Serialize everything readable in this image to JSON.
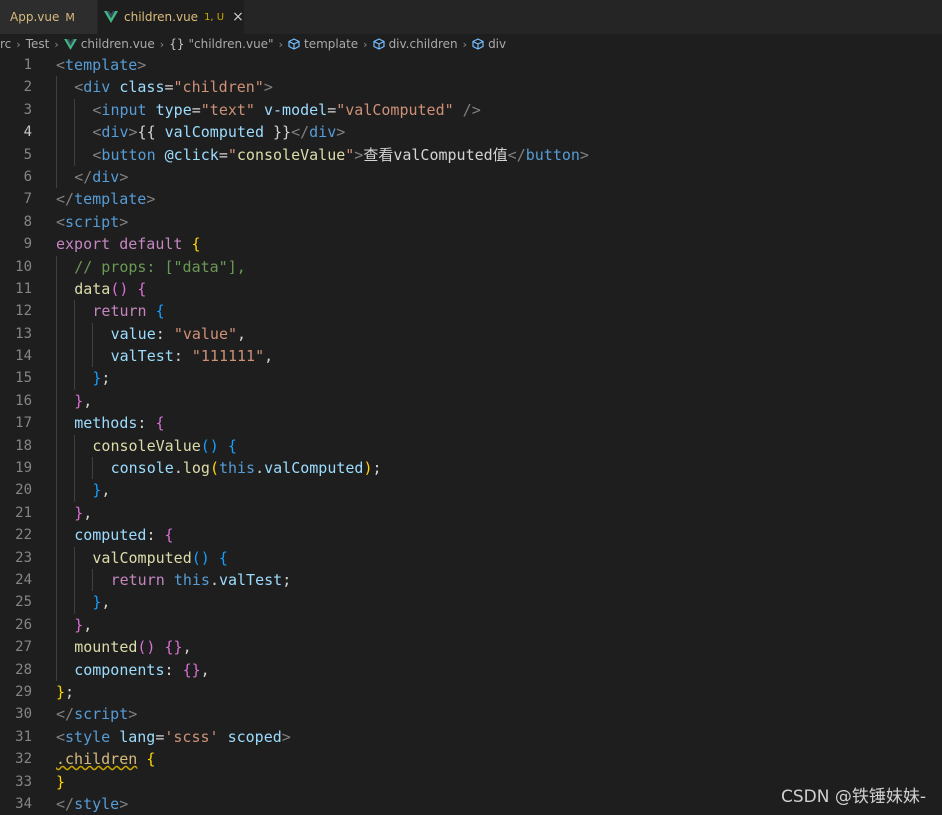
{
  "tabs": [
    {
      "label": "App.vue",
      "status": "M"
    },
    {
      "label": "children.vue",
      "status": "1, U",
      "close": "×"
    }
  ],
  "breadcrumb": [
    "rc",
    "Test",
    "children.vue",
    "\"children.vue\"",
    "template",
    "div.children",
    "div"
  ],
  "breadcrumb_braces": "{}",
  "editor": {
    "current_line": 4,
    "lines": [
      {
        "n": "1",
        "indent": 0,
        "tokens": [
          [
            "t-punct",
            "<"
          ],
          [
            "t-tag",
            "template"
          ],
          [
            "t-punct",
            ">"
          ]
        ]
      },
      {
        "n": "2",
        "indent": 1,
        "tokens": [
          [
            "t-punct",
            "<"
          ],
          [
            "t-tag",
            "div"
          ],
          [
            "t-text",
            " "
          ],
          [
            "t-attr",
            "class"
          ],
          [
            "t-text",
            "="
          ],
          [
            "t-str",
            "\"children\""
          ],
          [
            "t-punct",
            ">"
          ]
        ]
      },
      {
        "n": "3",
        "indent": 2,
        "tokens": [
          [
            "t-punct",
            "<"
          ],
          [
            "t-tag",
            "input"
          ],
          [
            "t-text",
            " "
          ],
          [
            "t-attr",
            "type"
          ],
          [
            "t-text",
            "="
          ],
          [
            "t-str",
            "\"text\""
          ],
          [
            "t-text",
            " "
          ],
          [
            "t-attr",
            "v-model"
          ],
          [
            "t-text",
            "="
          ],
          [
            "t-str",
            "\"valComputed\""
          ],
          [
            "t-text",
            " "
          ],
          [
            "t-punct",
            "/>"
          ]
        ]
      },
      {
        "n": "4",
        "indent": 2,
        "tokens": [
          [
            "t-punct",
            "<"
          ],
          [
            "t-tag",
            "div"
          ],
          [
            "t-punct",
            ">"
          ],
          [
            "t-text",
            "{{ "
          ],
          [
            "t-prop",
            "valComputed"
          ],
          [
            "t-text",
            " }}"
          ],
          [
            "t-punct",
            "</"
          ],
          [
            "t-tag",
            "div"
          ],
          [
            "t-punct",
            ">"
          ]
        ]
      },
      {
        "n": "5",
        "indent": 2,
        "tokens": [
          [
            "t-punct",
            "<"
          ],
          [
            "t-tag",
            "button"
          ],
          [
            "t-text",
            " "
          ],
          [
            "t-attr",
            "@click"
          ],
          [
            "t-text",
            "="
          ],
          [
            "t-str",
            "\""
          ],
          [
            "t-fn",
            "consoleValue"
          ],
          [
            "t-str",
            "\""
          ],
          [
            "t-punct",
            ">"
          ],
          [
            "t-text",
            "查看valComputed值"
          ],
          [
            "t-punct",
            "</"
          ],
          [
            "t-tag",
            "button"
          ],
          [
            "t-punct",
            ">"
          ]
        ]
      },
      {
        "n": "6",
        "indent": 1,
        "tokens": [
          [
            "t-punct",
            "</"
          ],
          [
            "t-tag",
            "div"
          ],
          [
            "t-punct",
            ">"
          ]
        ]
      },
      {
        "n": "7",
        "indent": 0,
        "tokens": [
          [
            "t-punct",
            "</"
          ],
          [
            "t-tag",
            "template"
          ],
          [
            "t-punct",
            ">"
          ]
        ]
      },
      {
        "n": "8",
        "indent": 0,
        "tokens": [
          [
            "t-punct",
            "<"
          ],
          [
            "t-tag",
            "script"
          ],
          [
            "t-punct",
            ">"
          ]
        ]
      },
      {
        "n": "9",
        "indent": 0,
        "tokens": [
          [
            "t-kw",
            "export"
          ],
          [
            "t-text",
            " "
          ],
          [
            "t-kw",
            "default"
          ],
          [
            "t-text",
            " "
          ],
          [
            "t-br1",
            "{"
          ]
        ]
      },
      {
        "n": "10",
        "indent": 1,
        "tokens": [
          [
            "t-comment",
            "// props: [\"data\"],"
          ]
        ]
      },
      {
        "n": "11",
        "indent": 1,
        "tokens": [
          [
            "t-fn",
            "data"
          ],
          [
            "t-br2",
            "()"
          ],
          [
            "t-text",
            " "
          ],
          [
            "t-br2",
            "{"
          ]
        ]
      },
      {
        "n": "12",
        "indent": 2,
        "tokens": [
          [
            "t-kw",
            "return"
          ],
          [
            "t-text",
            " "
          ],
          [
            "t-br3",
            "{"
          ]
        ]
      },
      {
        "n": "13",
        "indent": 3,
        "tokens": [
          [
            "t-prop",
            "value"
          ],
          [
            "t-text",
            ": "
          ],
          [
            "t-str",
            "\"value\""
          ],
          [
            "t-text",
            ","
          ]
        ]
      },
      {
        "n": "14",
        "indent": 3,
        "tokens": [
          [
            "t-prop",
            "valTest"
          ],
          [
            "t-text",
            ": "
          ],
          [
            "t-str",
            "\"111111\""
          ],
          [
            "t-text",
            ","
          ]
        ]
      },
      {
        "n": "15",
        "indent": 2,
        "tokens": [
          [
            "t-br3",
            "}"
          ],
          [
            "t-text",
            ";"
          ]
        ]
      },
      {
        "n": "16",
        "indent": 1,
        "tokens": [
          [
            "t-br2",
            "}"
          ],
          [
            "t-text",
            ","
          ]
        ]
      },
      {
        "n": "17",
        "indent": 1,
        "tokens": [
          [
            "t-prop",
            "methods"
          ],
          [
            "t-text",
            ": "
          ],
          [
            "t-br2",
            "{"
          ]
        ]
      },
      {
        "n": "18",
        "indent": 2,
        "tokens": [
          [
            "t-fn",
            "consoleValue"
          ],
          [
            "t-br3",
            "()"
          ],
          [
            "t-text",
            " "
          ],
          [
            "t-br3",
            "{"
          ]
        ]
      },
      {
        "n": "19",
        "indent": 3,
        "tokens": [
          [
            "t-prop",
            "console"
          ],
          [
            "t-text",
            "."
          ],
          [
            "t-fn",
            "log"
          ],
          [
            "t-br1",
            "("
          ],
          [
            "t-kw2",
            "this"
          ],
          [
            "t-text",
            "."
          ],
          [
            "t-prop",
            "valComputed"
          ],
          [
            "t-br1",
            ")"
          ],
          [
            "t-text",
            ";"
          ]
        ]
      },
      {
        "n": "20",
        "indent": 2,
        "tokens": [
          [
            "t-br3",
            "}"
          ],
          [
            "t-text",
            ","
          ]
        ]
      },
      {
        "n": "21",
        "indent": 1,
        "tokens": [
          [
            "t-br2",
            "}"
          ],
          [
            "t-text",
            ","
          ]
        ]
      },
      {
        "n": "22",
        "indent": 1,
        "tokens": [
          [
            "t-prop",
            "computed"
          ],
          [
            "t-text",
            ": "
          ],
          [
            "t-br2",
            "{"
          ]
        ]
      },
      {
        "n": "23",
        "indent": 2,
        "tokens": [
          [
            "t-fn",
            "valComputed"
          ],
          [
            "t-br3",
            "()"
          ],
          [
            "t-text",
            " "
          ],
          [
            "t-br3",
            "{"
          ]
        ]
      },
      {
        "n": "24",
        "indent": 3,
        "tokens": [
          [
            "t-kw",
            "return"
          ],
          [
            "t-text",
            " "
          ],
          [
            "t-kw2",
            "this"
          ],
          [
            "t-text",
            "."
          ],
          [
            "t-prop",
            "valTest"
          ],
          [
            "t-text",
            ";"
          ]
        ]
      },
      {
        "n": "25",
        "indent": 2,
        "tokens": [
          [
            "t-br3",
            "}"
          ],
          [
            "t-text",
            ","
          ]
        ]
      },
      {
        "n": "26",
        "indent": 1,
        "tokens": [
          [
            "t-br2",
            "}"
          ],
          [
            "t-text",
            ","
          ]
        ]
      },
      {
        "n": "27",
        "indent": 1,
        "tokens": [
          [
            "t-fn",
            "mounted"
          ],
          [
            "t-br2",
            "()"
          ],
          [
            "t-text",
            " "
          ],
          [
            "t-br2",
            "{}"
          ],
          [
            "t-text",
            ","
          ]
        ]
      },
      {
        "n": "28",
        "indent": 1,
        "tokens": [
          [
            "t-prop",
            "components"
          ],
          [
            "t-text",
            ": "
          ],
          [
            "t-br2",
            "{}"
          ],
          [
            "t-text",
            ","
          ]
        ]
      },
      {
        "n": "29",
        "indent": 0,
        "tokens": [
          [
            "t-br1",
            "}"
          ],
          [
            "t-text",
            ";"
          ]
        ]
      },
      {
        "n": "30",
        "indent": 0,
        "tokens": [
          [
            "t-punct",
            "</"
          ],
          [
            "t-tag",
            "script"
          ],
          [
            "t-punct",
            ">"
          ]
        ]
      },
      {
        "n": "31",
        "indent": 0,
        "tokens": [
          [
            "t-punct",
            "<"
          ],
          [
            "t-tag",
            "style"
          ],
          [
            "t-text",
            " "
          ],
          [
            "t-attr",
            "lang"
          ],
          [
            "t-text",
            "="
          ],
          [
            "t-str",
            "'scss'"
          ],
          [
            "t-text",
            " "
          ],
          [
            "t-attr",
            "scoped"
          ],
          [
            "t-punct",
            ">"
          ]
        ]
      },
      {
        "n": "32",
        "indent": 0,
        "tokens": [
          [
            "t-sel",
            ".children"
          ],
          [
            "t-text",
            " "
          ],
          [
            "t-br1",
            "{"
          ]
        ]
      },
      {
        "n": "33",
        "indent": 0,
        "tokens": [
          [
            "t-br1",
            "}"
          ]
        ]
      },
      {
        "n": "34",
        "indent": 0,
        "tokens": [
          [
            "t-punct",
            "</"
          ],
          [
            "t-tag",
            "style"
          ],
          [
            "t-punct",
            ">"
          ]
        ]
      }
    ]
  },
  "watermark": "CSDN @铁锤妹妹-",
  "colors": {
    "background": "#1e1e1e",
    "tabbar": "#252526",
    "modified": "#d7ba7d",
    "vue_green": "#41b883"
  },
  "icons": [
    "vue-logo-icon",
    "close-icon",
    "chevron-right-icon",
    "cube-icon"
  ]
}
